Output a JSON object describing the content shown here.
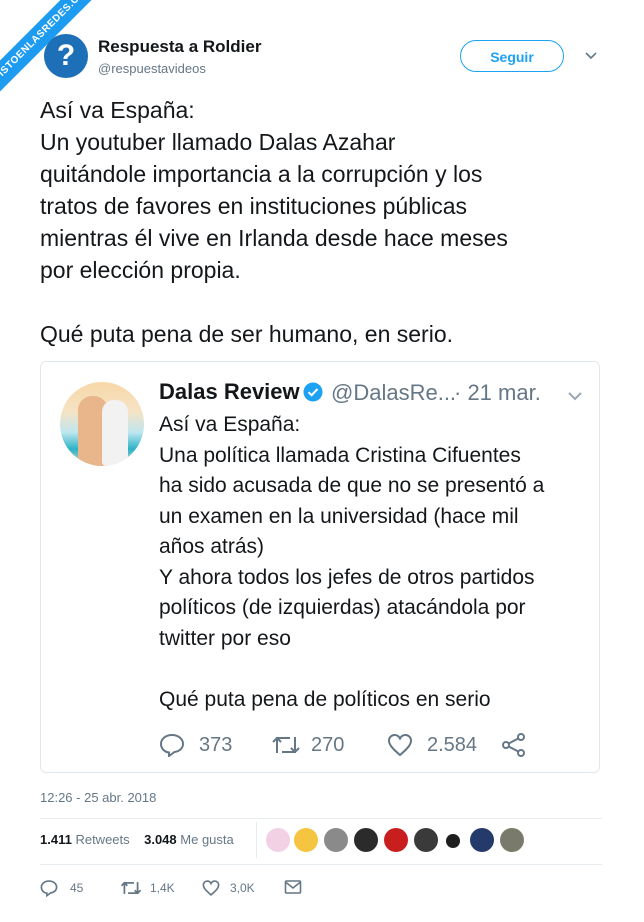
{
  "watermark": "VISTOENLASREDES.COM",
  "author": {
    "name": "Respuesta a Roldier",
    "handle": "@respuestavideos",
    "avatar_icon": "question-mark-icon"
  },
  "follow_label": "Seguir",
  "tweet": {
    "lines": [
      "Así va España:",
      "Un youtuber llamado Dalas Azahar",
      "quitándole importancia a la corrupción y los",
      "tratos de favores en instituciones públicas",
      "mientras él vive en Irlanda desde hace meses",
      "por elección propia.",
      "",
      "Qué puta pena de ser humano, en serio."
    ]
  },
  "quoted": {
    "name": "Dalas Review",
    "handle": "@DalasRe...",
    "date": "· 21 mar.",
    "lines": [
      "Así va España:",
      "Una política llamada Cristina Cifuentes",
      "ha sido acusada de que no se presentó a",
      "un examen en la universidad (hace mil",
      "años atrás)",
      "Y ahora todos los jefes de otros partidos",
      "políticos (de izquierdas) atacándola por",
      "twitter por eso",
      "",
      "Qué puta pena de políticos en serio"
    ],
    "replies": "373",
    "retweets": "270",
    "likes": "2.584"
  },
  "timestamp": "12:26 - 25 abr. 2018",
  "stats": {
    "retweets_count": "1.411",
    "retweets_label": "Retweets",
    "likes_count": "3.048",
    "likes_label": "Me gusta"
  },
  "likers": [
    "#f3d1e4",
    "#f5c542",
    "#8a8a8a",
    "#2b2b2b",
    "#c81e1e",
    "#3a3a3a",
    "#1e1e1e",
    "#243a6b",
    "#7a7a6a"
  ],
  "actions": {
    "replies": "45",
    "retweets": "1,4K",
    "likes": "3,0K"
  },
  "colors": {
    "accent": "#1da1f2",
    "muted": "#657786",
    "watermark": "#1d9bf0"
  }
}
